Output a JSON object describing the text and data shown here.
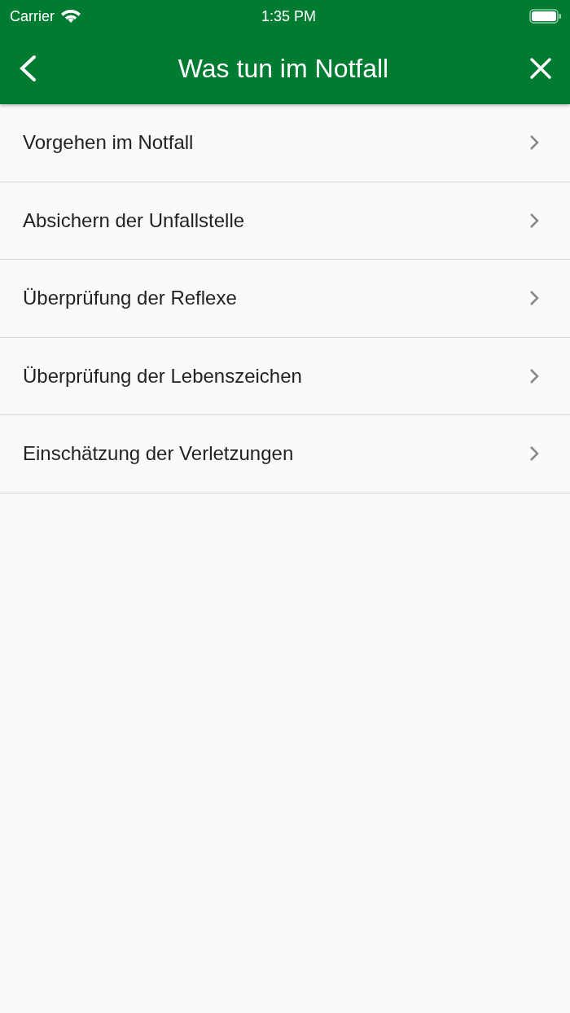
{
  "status_bar": {
    "carrier": "Carrier",
    "time": "1:35 PM"
  },
  "nav_bar": {
    "title": "Was tun im Notfall"
  },
  "items": [
    {
      "label": "Vorgehen im Notfall"
    },
    {
      "label": "Absichern der Unfallstelle"
    },
    {
      "label": "Überprüfung der Reflexe"
    },
    {
      "label": "Überprüfung der Lebenszeichen"
    },
    {
      "label": "Einschätzung der Verletzungen"
    }
  ]
}
